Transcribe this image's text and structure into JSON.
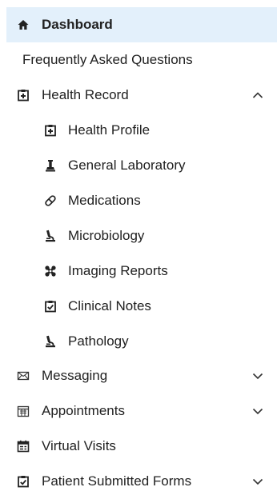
{
  "nav": {
    "dashboard": "Dashboard",
    "faq": "Frequently Asked Questions",
    "health_record": "Health Record",
    "health_record_children": [
      "Health Profile",
      "General Laboratory",
      "Medications",
      "Microbiology",
      "Imaging Reports",
      "Clinical Notes",
      "Pathology"
    ],
    "messaging": "Messaging",
    "appointments": "Appointments",
    "virtual_visits": "Virtual Visits",
    "patient_forms": "Patient Submitted Forms"
  },
  "colors": {
    "active_bg": "#e3f0fb",
    "text": "#212121"
  },
  "icons": {
    "dashboard": "home-icon",
    "health_record": "medical-file-icon",
    "health_profile": "medical-file-icon",
    "general_laboratory": "lab-flask-icon",
    "medications": "pill-icon",
    "microbiology": "microscope-icon",
    "imaging_reports": "xray-icon",
    "clinical_notes": "clipboard-check-icon",
    "pathology": "microscope-icon",
    "messaging": "envelope-icon",
    "appointments": "calendar-icon",
    "virtual_visits": "calendar-video-icon",
    "patient_forms": "clipboard-check-icon"
  }
}
